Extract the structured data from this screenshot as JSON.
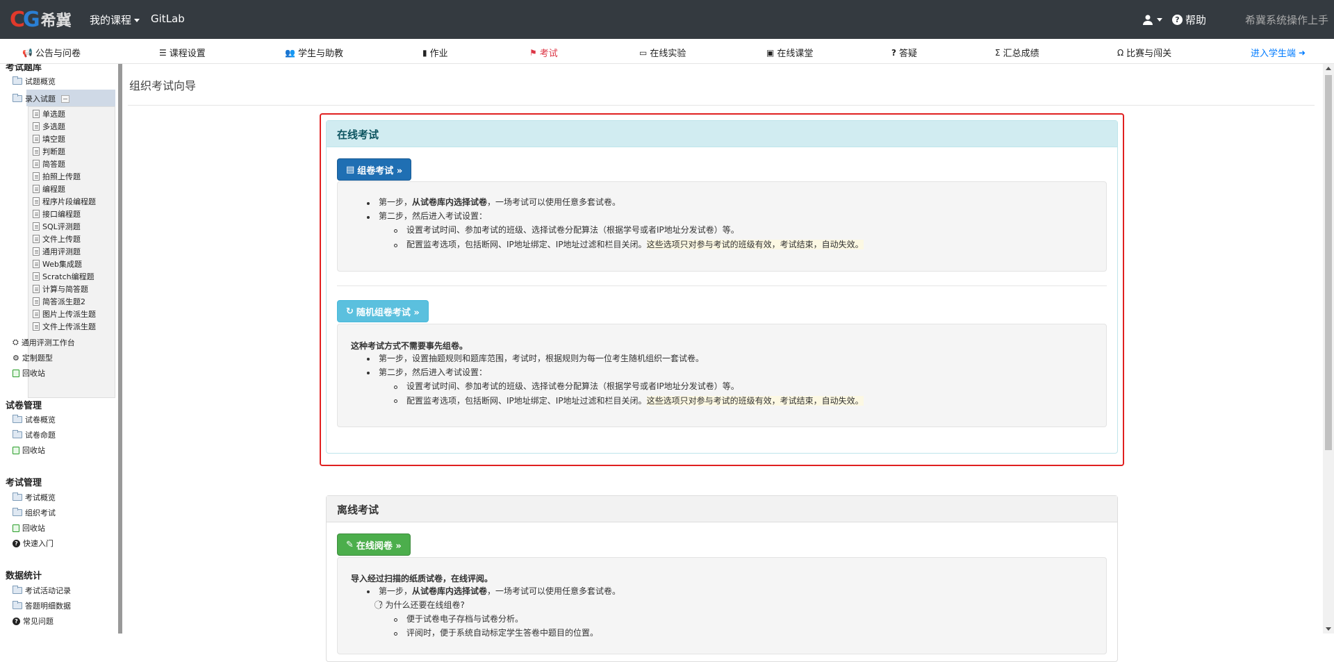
{
  "topbar": {
    "logo_text_c": "C",
    "logo_text_g": "G",
    "logo_cn": "希冀",
    "my_courses": "我的课程",
    "gitlab": "GitLab",
    "help": "帮助",
    "system_link": "希冀系统操作上手"
  },
  "subnav": [
    {
      "label": "公告与问卷",
      "icon": "megaphone-icon"
    },
    {
      "label": "课程设置",
      "icon": "list-icon"
    },
    {
      "label": "学生与助教",
      "icon": "users-icon"
    },
    {
      "label": "作业",
      "icon": "book-icon"
    },
    {
      "label": "考试",
      "icon": "exam-icon"
    },
    {
      "label": "在线实验",
      "icon": "laptop-icon"
    },
    {
      "label": "在线课堂",
      "icon": "screen-icon"
    },
    {
      "label": "答疑",
      "icon": "question-icon"
    },
    {
      "label": "汇总成绩",
      "icon": "sigma-icon"
    },
    {
      "label": "比赛与闯关",
      "icon": "medal-icon"
    },
    {
      "label": "进入学生端",
      "icon": "arrow-right-circle-icon"
    }
  ],
  "sidebar": {
    "section_exam_bank": "考试题库",
    "bank_overview": "试题概览",
    "entry": "录入试题",
    "entry_items": [
      "单选题",
      "多选题",
      "填空题",
      "判断题",
      "简答题",
      "拍照上传题",
      "编程题",
      "程序片段编程题",
      "接口编程题",
      "SQL评测题",
      "文件上传题",
      "通用评测题",
      "Web集成题",
      "Scratch编程题",
      "计算与简答题",
      "简答派生题2",
      "图片上传派生题",
      "文件上传派生题"
    ],
    "general_workbench": "通用评测工作台",
    "custom_type": "定制题型",
    "recycle1": "回收站",
    "section_paper": "试卷管理",
    "paper_overview": "试卷概览",
    "paper_assign": "试卷命题",
    "recycle2": "回收站",
    "section_exam": "考试管理",
    "exam_overview": "考试概览",
    "organize_exam": "组织考试",
    "recycle3": "回收站",
    "quick_start": "快速入门",
    "section_stats": "数据统计",
    "activity_log": "考试活动记录",
    "answer_detail": "答题明细数据",
    "faq": "常见问题"
  },
  "main": {
    "title": "组织考试向导",
    "online": {
      "header": "在线考试",
      "btn_compose": "组卷考试 »",
      "compose": {
        "s1_prefix": "第一步，",
        "s1_bold": "从试卷库内选择试卷",
        "s1_suffix": "，一场考试可以使用任意多套试卷。",
        "s2": "第二步，然后进入考试设置：",
        "s2a": "设置考试时间、参加考试的班级、选择试卷分配算法（根据学号或者IP地址分发试卷）等。",
        "s2b_prefix": "配置监考选项，包括断网、IP地址绑定、IP地址过滤和栏目关闭。",
        "s2b_hl": "这些选项只对参与考试的班级有效，考试结束，自动失效。"
      },
      "btn_random": "随机组卷考试 »",
      "random": {
        "intro": "这种考试方式不需要事先组卷。",
        "s1": "第一步，设置抽题规则和题库范围，考试时，根据规则为每一位考生随机组织一套试卷。",
        "s2": "第二步，然后进入考试设置：",
        "s2a": "设置考试时间、参加考试的班级、选择试卷分配算法（根据学号或者IP地址分发试卷）等。",
        "s2b_prefix": "配置监考选项，包括断网、IP地址绑定、IP地址过滤和栏目关闭。",
        "s2b_hl": "这些选项只对参与考试的班级有效，考试结束，自动失效。"
      }
    },
    "offline": {
      "header": "离线考试",
      "btn_review": "在线阅卷 »",
      "intro": "导入经过扫描的纸质试卷，在线评阅。",
      "s1_prefix": "第一步，",
      "s1_bold": "从试卷库内选择试卷",
      "s1_suffix": "，一场考试可以使用任意多套试卷。",
      "why": "为什么还要在线组卷?",
      "why_a": "便于试卷电子存档与试卷分析。",
      "why_b": "评阅时，便于系统自动标定学生答卷中题目的位置。"
    }
  }
}
